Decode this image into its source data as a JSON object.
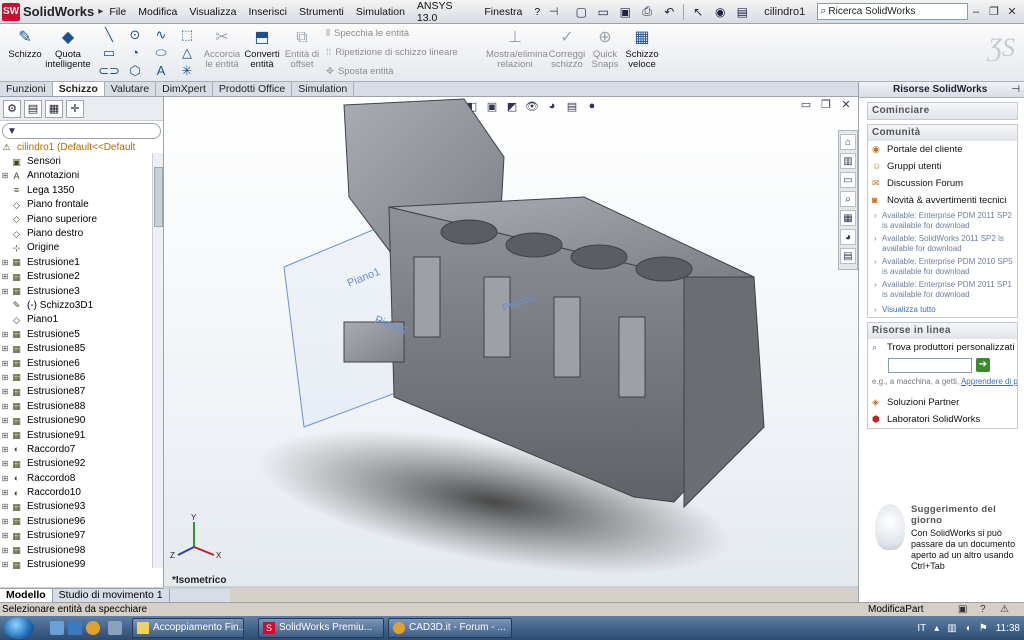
{
  "app": {
    "name": "SolidWorks",
    "brand_color": "#c8102e"
  },
  "menu": [
    "File",
    "Modifica",
    "Visualizza",
    "Inserisci",
    "Strumenti",
    "Simulation",
    "ANSYS 13.0",
    "Finestra",
    "?"
  ],
  "document_title": "cilindro1",
  "search": {
    "placeholder": "Ricerca SolidWorks"
  },
  "ribbon": {
    "schizzo": "Schizzo",
    "quota_line1": "Quota",
    "quota_line2": "intelligente",
    "accorcia_line1": "Accorcia",
    "accorcia_line2": "le entità",
    "converti_line1": "Converti",
    "converti_line2": "entità",
    "offset_line1": "Entità di",
    "offset_line2": "offset",
    "specchia": "Specchia le entità",
    "ripetizione": "Ripetizione di schizzo lineare",
    "sposta": "Sposta entità",
    "relazioni_line1": "Mostra/elimina",
    "relazioni_line2": "relazioni",
    "correggi_line1": "Correggi",
    "correggi_line2": "schizzo",
    "snaps_line1": "Quick",
    "snaps_line2": "Snaps",
    "veloce_line1": "Schizzo",
    "veloce_line2": "veloce"
  },
  "command_tabs": [
    "Funzioni",
    "Schizzo",
    "Valutare",
    "DimXpert",
    "Prodotti Office",
    "Simulation"
  ],
  "active_command_tab": "Schizzo",
  "feature_tree": {
    "root": "cilindro1  (Default<<Default",
    "items": [
      "Sensori",
      "Annotazioni",
      "Lega 1350",
      "Piano frontale",
      "Piano superiore",
      "Piano destro",
      "Origine",
      "Estrusione1",
      "Estrusione2",
      "Estrusione3",
      "(-) Schizzo3D1",
      "Piano1",
      "Estrusione5",
      "Estrusione85",
      "Estrusione6",
      "Estrusione86",
      "Estrusione87",
      "Estrusione88",
      "Estrusione90",
      "Estrusione91",
      "Raccordo7",
      "Estrusione92",
      "Raccordo8",
      "Raccordo10",
      "Estrusione93",
      "Estrusione96",
      "Estrusione97",
      "Estrusione98",
      "Estrusione99"
    ]
  },
  "bottom_tabs": [
    "Modello",
    "Studio di movimento 1"
  ],
  "viewport": {
    "view_label": "*Isometrico",
    "plane_labels": [
      "Piano1",
      "Piano1",
      "Piano1"
    ],
    "axis_labels": [
      "Y",
      "X",
      "Z"
    ]
  },
  "task_pane": {
    "title": "Risorse SolidWorks",
    "section_start": "Cominciare",
    "section_community": "Comunità",
    "links_community": [
      "Portale del cliente",
      "Gruppi utenti",
      "Discussion Forum",
      "Novità & avvertimenti tecnici"
    ],
    "news": [
      "Available: Enterprise PDM 2011 SP2 is available for download",
      "Available: SolidWorks 2011 SP2 is available for download",
      "Available: Enterprise PDM 2010 SP5 is available for download",
      "Available: Enterprise PDM 2011 SP1 is available for download"
    ],
    "view_all": "Visualizza tutto",
    "section_online": "Risorse in linea",
    "find_suppliers": "Trova produttori personalizzati",
    "hint": "e.g., a macchina, a getti, ",
    "hint_link": "Apprendere di più",
    "partner": "Soluzioni Partner",
    "labs": "Laboratori SolidWorks",
    "tip_title": "Suggerimento del giorno",
    "tip_text": "Con SolidWorks si può passare da un documento aperto ad un altro usando Ctrl+Tab"
  },
  "status": {
    "left": "Selezionare entità da specchiare",
    "right": "ModificaPart"
  },
  "taskbar": {
    "buttons": [
      "Accoppiamento Fin...",
      "SolidWorks Premiu...",
      "CAD3D.it - Forum - ..."
    ],
    "lang": "IT",
    "time": "11:38"
  }
}
